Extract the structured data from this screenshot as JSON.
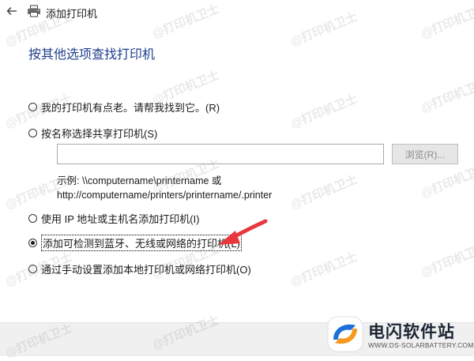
{
  "window": {
    "title": "添加打印机",
    "back_icon": "back-arrow-icon",
    "printer_icon": "printer-icon"
  },
  "page": {
    "heading": "按其他选项查找打印机"
  },
  "options": [
    {
      "label": "我的打印机有点老。请帮我找到它。(R)",
      "checked": false
    },
    {
      "label": "按名称选择共享打印机(S)",
      "checked": false
    },
    {
      "label": "使用 IP 地址或主机名添加打印机(I)",
      "checked": false
    },
    {
      "label": "添加可检测到蓝牙、无线或网络的打印机(L)",
      "checked": true
    },
    {
      "label": "通过手动设置添加本地打印机或网络打印机(O)",
      "checked": false
    }
  ],
  "shared_printer": {
    "input_value": "",
    "browse_label": "浏览(R)...",
    "example_line1": "示例: \\\\computername\\printername 或",
    "example_line2": "http://computername/printers/printername/.printer"
  },
  "annotation": {
    "arrow_color": "#e8383d"
  },
  "brand": {
    "name": "电闪软件站",
    "site": "WWW.DS-SOLARBATTERY.COM",
    "colors": {
      "blue": "#1e6fd9",
      "orange": "#f39a1e"
    }
  },
  "watermark": {
    "text": "@打印机卫士"
  }
}
